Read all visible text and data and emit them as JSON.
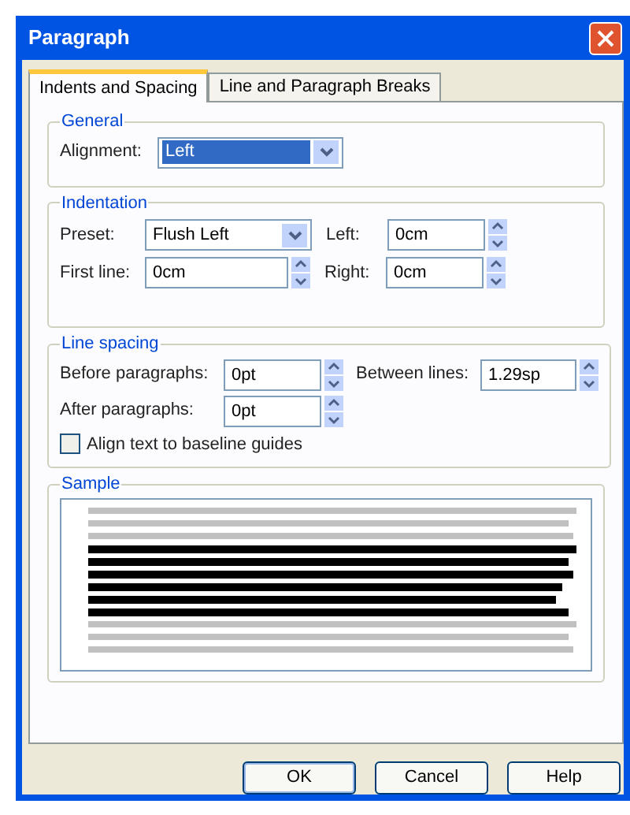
{
  "window": {
    "title": "Paragraph"
  },
  "tabs": [
    {
      "label": "Indents and Spacing",
      "selected": true
    },
    {
      "label": "Line and Paragraph Breaks",
      "selected": false
    }
  ],
  "general": {
    "title": "General",
    "alignment": {
      "label": "Alignment:",
      "value": "Left",
      "selected": true
    }
  },
  "indentation": {
    "title": "Indentation",
    "preset": {
      "label": "Preset:",
      "value": "Flush Left"
    },
    "left": {
      "label": "Left:",
      "value": "0cm"
    },
    "first_line": {
      "label": "First line:",
      "value": "0cm"
    },
    "right": {
      "label": "Right:",
      "value": "0cm"
    }
  },
  "line_spacing": {
    "title": "Line spacing",
    "before_paragraphs": {
      "label": "Before paragraphs:",
      "value": "0pt"
    },
    "between_lines": {
      "label": "Between lines:",
      "value": "1.29sp"
    },
    "after_paragraphs": {
      "label": "After paragraphs:",
      "value": "0pt"
    },
    "align_to_baseline": {
      "label": "Align text to baseline guides",
      "checked": false
    }
  },
  "sample": {
    "title": "Sample"
  },
  "buttons": [
    {
      "label": "OK",
      "default": true
    },
    {
      "label": "Cancel",
      "default": false
    },
    {
      "label": "Help",
      "default": false
    }
  ]
}
